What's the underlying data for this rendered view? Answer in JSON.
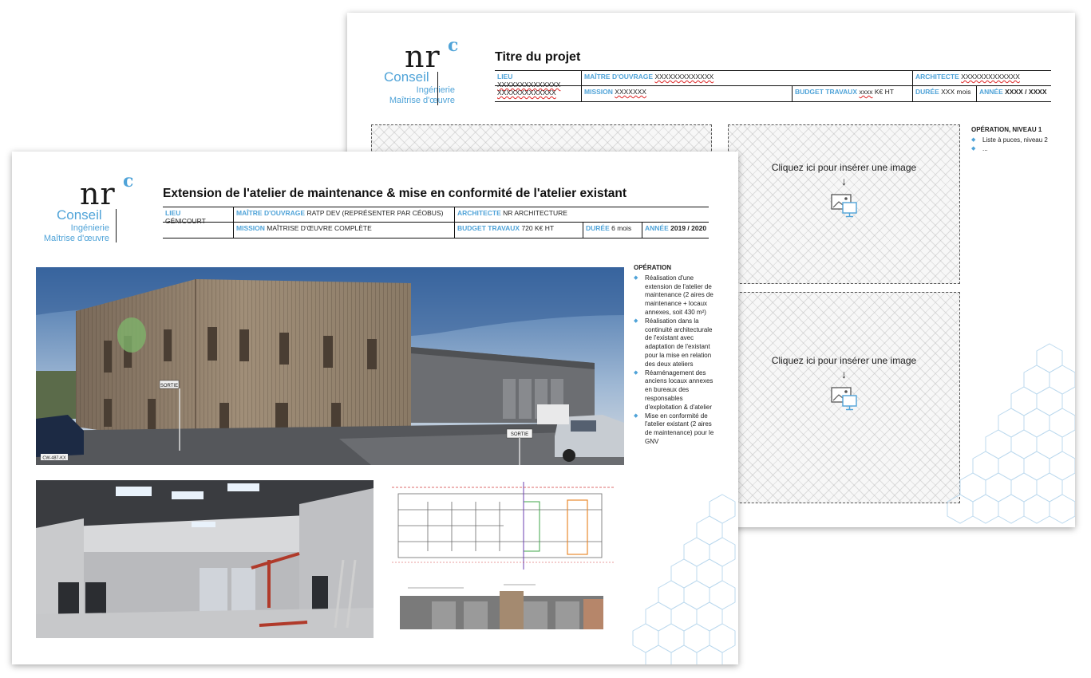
{
  "brand": {
    "logo_nr": "nr",
    "logo_c": "c",
    "conseil": "Conseil",
    "ingenierie": "Ingénierie",
    "maitrise": "Maîtrise d'œuvre",
    "accent_color": "#4fa3d8"
  },
  "template_page": {
    "title": "Titre du projet",
    "info": {
      "lieu_label": "LIEU",
      "lieu_value_1": "XXXXXXXXXXXXXX",
      "lieu_value_2": "XXXXXXXXXXXXX",
      "maitre_label": "MAÎTRE D'OUVRAGE",
      "maitre_value": "XXXXXXXXXXXXX",
      "architecte_label": "ARCHITECTE",
      "architecte_value": "XXXXXXXXXXXXX",
      "mission_label": "MISSION",
      "mission_value": "XXXXXXX",
      "budget_label": "BUDGET TRAVAUX",
      "budget_value_x": "xxxx",
      "budget_value_unit": "K€ HT",
      "duree_label": "DURÉE",
      "duree_value": "XXX mois",
      "annee_label": "ANNÉE",
      "annee_value": "XXXX / XXXX"
    },
    "placeholder_text": "Cliquez ici pour insérer une image",
    "placeholder_arrow": "↓",
    "operation": {
      "title": "OPÉRATION, NIVEAU 1",
      "items": [
        "Liste à puces, niveau 2",
        "..."
      ]
    }
  },
  "project_page": {
    "title": "Extension de l'atelier de maintenance & mise en conformité de l'atelier existant",
    "info": {
      "lieu_label": "LIEU",
      "lieu_value": "GÉNICOURT",
      "maitre_label": "MAÎTRE D'OUVRAGE",
      "maitre_value": "RATP DEV (REPRÉSENTER PAR CÉOBUS)",
      "architecte_label": "ARCHITECTE",
      "architecte_value": "NR ARCHITECTURE",
      "mission_label": "MISSION",
      "mission_value": "MAÎTRISE D'ŒUVRE COMPLÈTE",
      "budget_label": "BUDGET TRAVAUX",
      "budget_value": "720 K€ HT",
      "duree_label": "DURÉE",
      "duree_value": "6 mois",
      "annee_label": "ANNÉE",
      "annee_value": "2019 / 2020"
    },
    "operation": {
      "title": "OPÉRATION",
      "items": [
        "Réalisation d'une extension de l'atelier de maintenance (2 aires de maintenance + locaux annexes, soit 430 m²)",
        "Réalisation dans la continuité architecturale de l'existant avec adaptation de l'existant pour la mise en relation des deux ateliers",
        "Réaménagement des anciens locaux annexes en bureaux des responsables d'exploitation & d'atelier",
        "Mise en conformité de l'atelier existant (2 aires de maintenance) pour le GNV"
      ]
    },
    "photo_signs": {
      "sortie_1": "SORTIE",
      "sortie_2": "SORTIE",
      "plate": "CW-487-KX"
    }
  }
}
